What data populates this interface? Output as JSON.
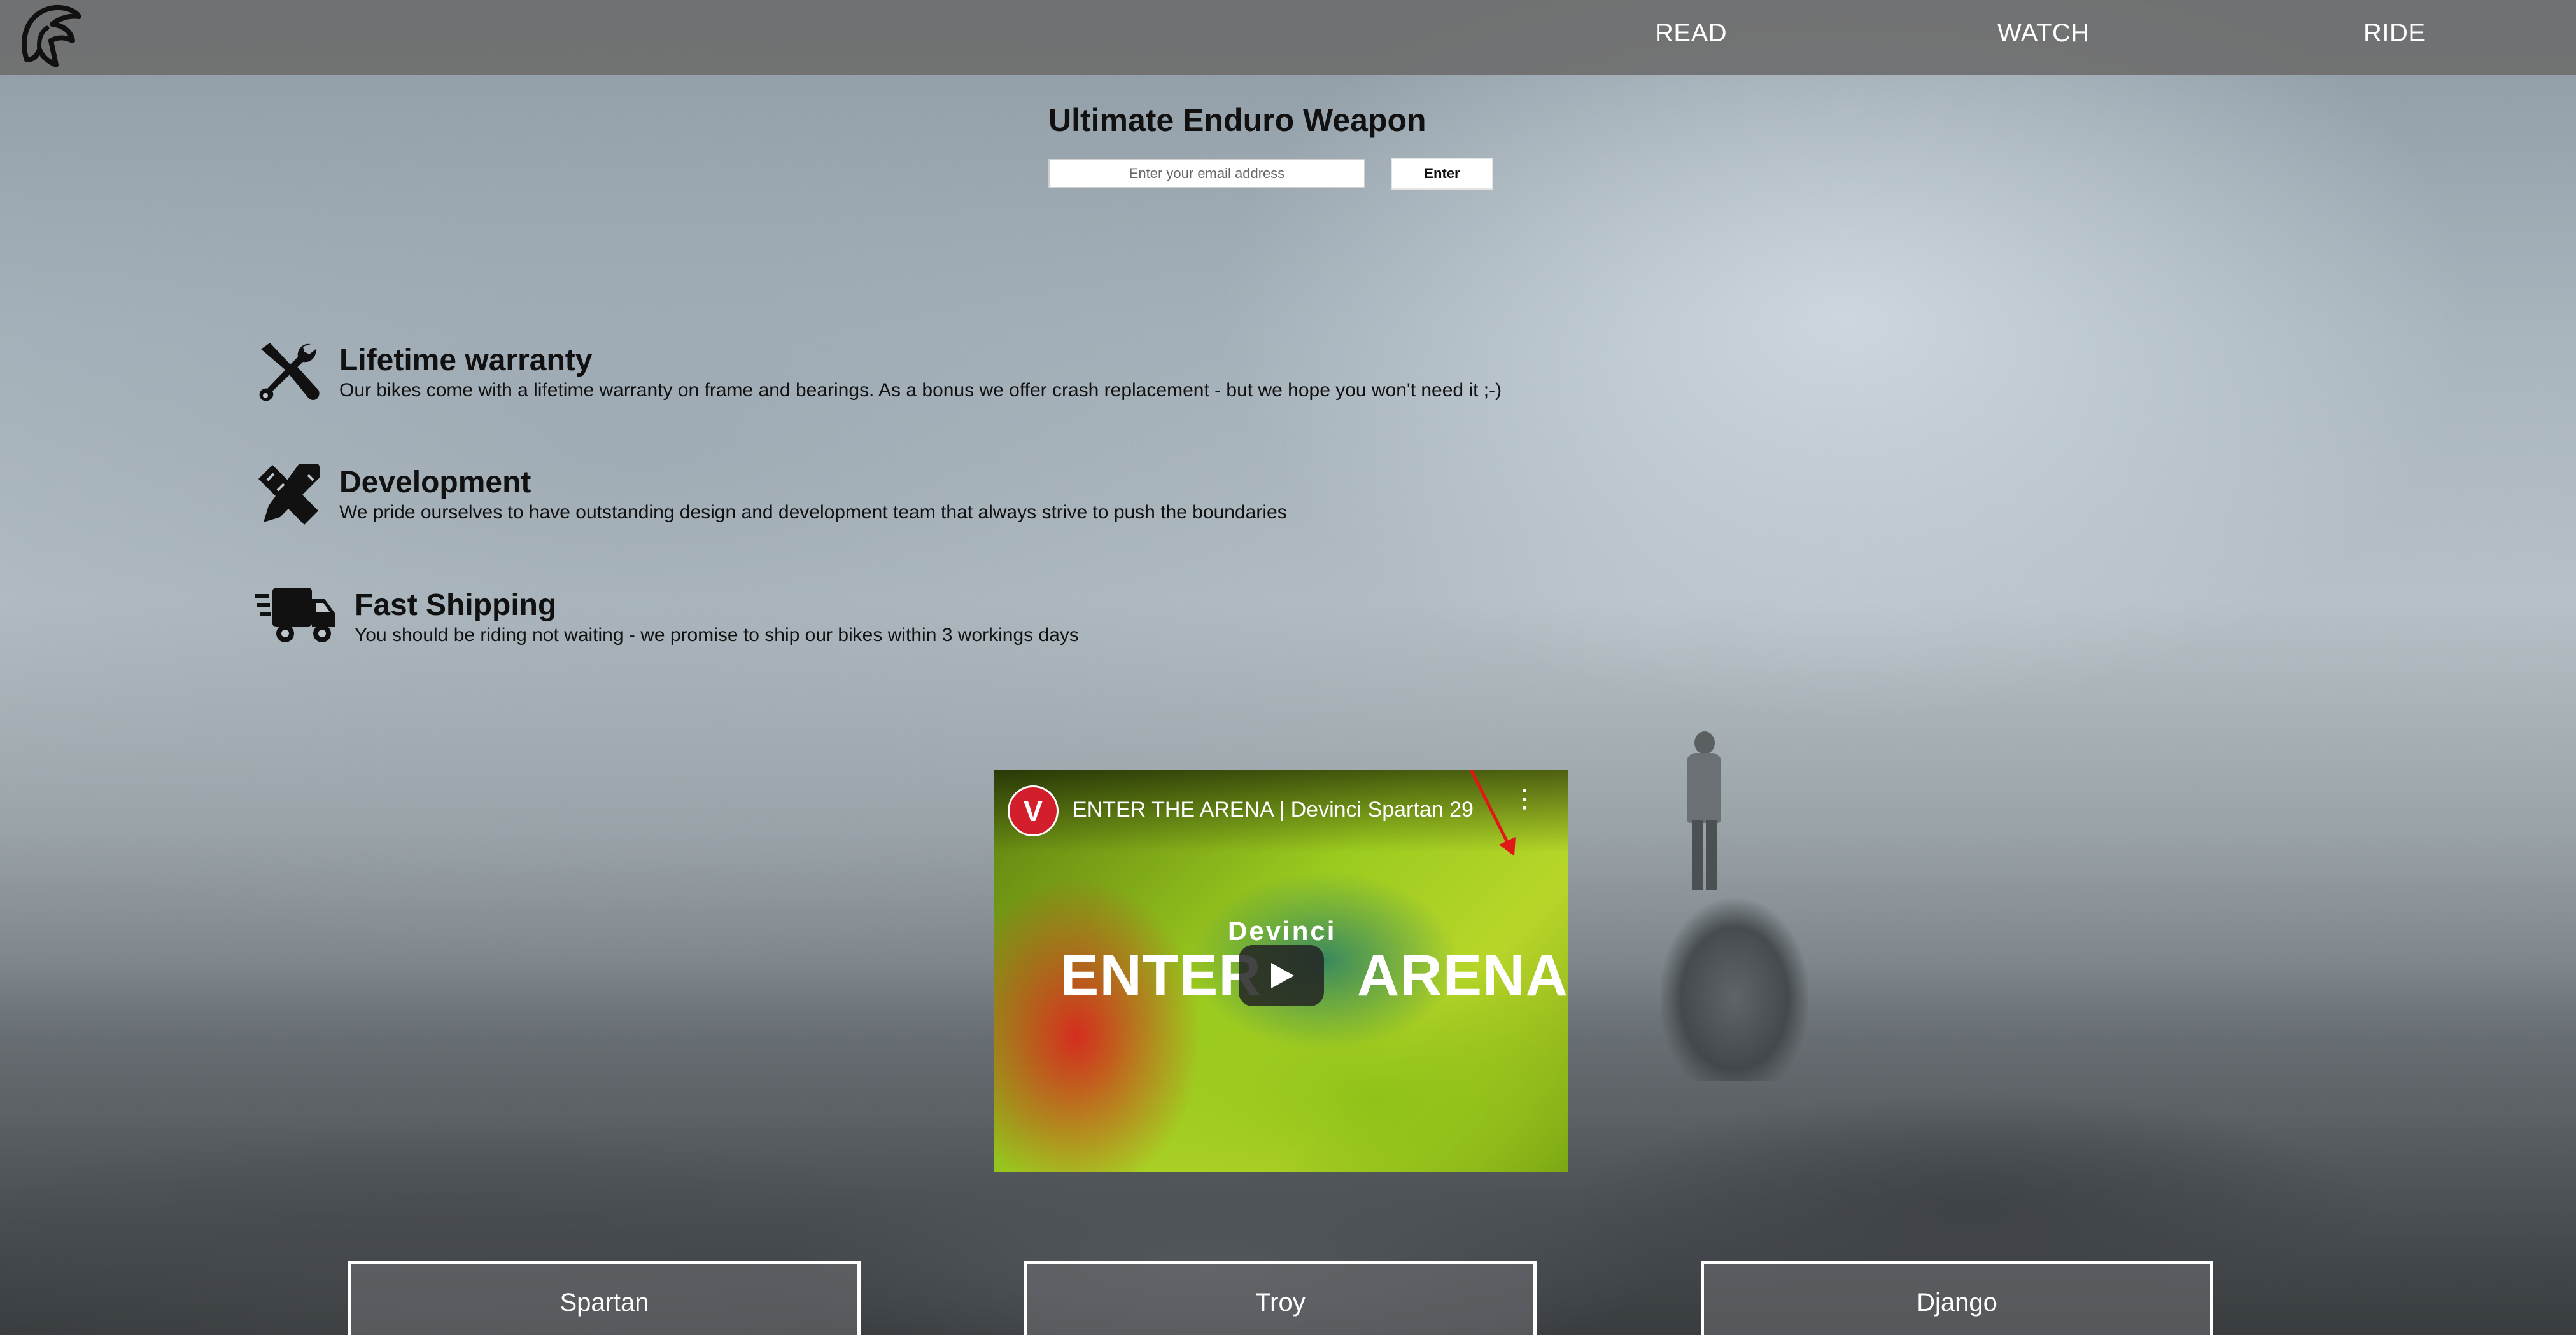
{
  "nav": {
    "items": [
      {
        "label": "READ"
      },
      {
        "label": "WATCH"
      },
      {
        "label": "RIDE"
      }
    ]
  },
  "hero": {
    "title": "Ultimate Enduro Weapon",
    "email_placeholder": "Enter your email address",
    "submit_label": "Enter"
  },
  "features": [
    {
      "title": "Lifetime warranty",
      "description": "Our bikes come with a lifetime warranty on frame and bearings. As a bonus we offer crash replacement - but we hope you won't need it ;-)",
      "icon": "tools-icon"
    },
    {
      "title": "Development",
      "description": "We pride ourselves to have outstanding design and development team that always strive to push the boundaries",
      "icon": "pencil-ruler-icon"
    },
    {
      "title": "Fast Shipping",
      "description": "You should be riding not waiting - we promise to ship our bikes within 3 workings days",
      "icon": "shipping-truck-icon"
    }
  ],
  "video": {
    "title": "ENTER THE ARENA | Devinci Spartan 29",
    "brand": "Devinci",
    "overlay_left": "ENTER",
    "overlay_right": "ARENA",
    "channel_initial": "V"
  },
  "bikes": [
    {
      "label": "Spartan"
    },
    {
      "label": "Troy"
    },
    {
      "label": "Django"
    }
  ],
  "colors": {
    "navbar": "#6e6e6e",
    "accent_red": "#d21f2b",
    "video_green": "#9ccb1f"
  }
}
